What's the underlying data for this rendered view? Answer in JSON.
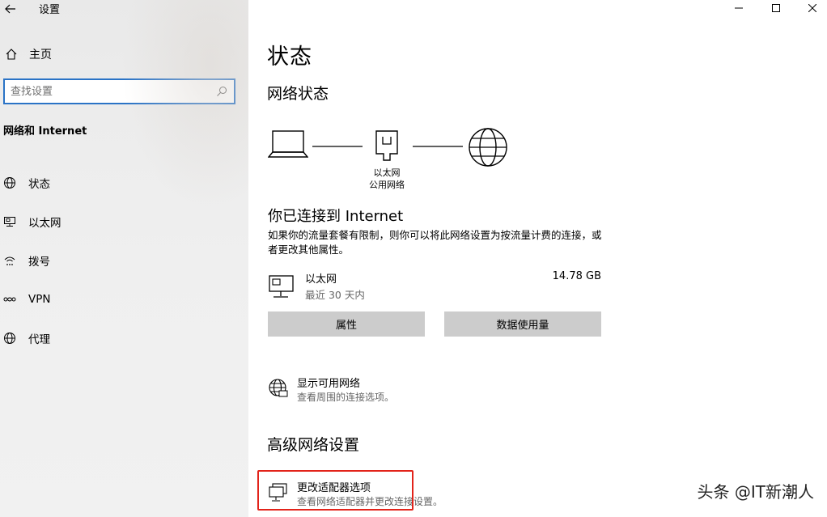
{
  "window": {
    "title": "设置",
    "back_icon": "back-arrow-icon",
    "controls": [
      "minimize-icon",
      "maximize-icon",
      "close-icon"
    ]
  },
  "sidebar": {
    "home_label": "主页",
    "search_placeholder": "查找设置",
    "section_title": "网络和 Internet",
    "items": [
      {
        "label": "状态",
        "icon": "globe-icon"
      },
      {
        "label": "以太网",
        "icon": "ethernet-icon"
      },
      {
        "label": "拨号",
        "icon": "dialup-icon"
      },
      {
        "label": "VPN",
        "icon": "vpn-icon"
      },
      {
        "label": "代理",
        "icon": "globe-icon"
      }
    ]
  },
  "main": {
    "page_title": "状态",
    "network_status_heading": "网络状态",
    "diagram": {
      "adapter_name": "以太网",
      "network_name": "公用网络"
    },
    "connected_title": "你已连接到 Internet",
    "connected_desc": "如果你的流量套餐有限制，则你可以将此网络设置为按流量计费的连接，或者更改其他属性。",
    "ethernet": {
      "name": "以太网",
      "period": "最近 30 天内",
      "usage": "14.78 GB"
    },
    "buttons": {
      "properties": "属性",
      "data_usage": "数据使用量"
    },
    "show_networks": {
      "title": "显示可用网络",
      "subtitle": "查看周围的连接选项。"
    },
    "advanced_heading": "高级网络设置",
    "change_adapter": {
      "title": "更改适配器选项",
      "subtitle": "查看网络适配器并更改连接设置。"
    }
  },
  "watermark": "头条 @IT新潮人",
  "colors": {
    "accent": "#2a73c6",
    "highlight": "#e2231a",
    "button_bg": "#cccccc"
  }
}
